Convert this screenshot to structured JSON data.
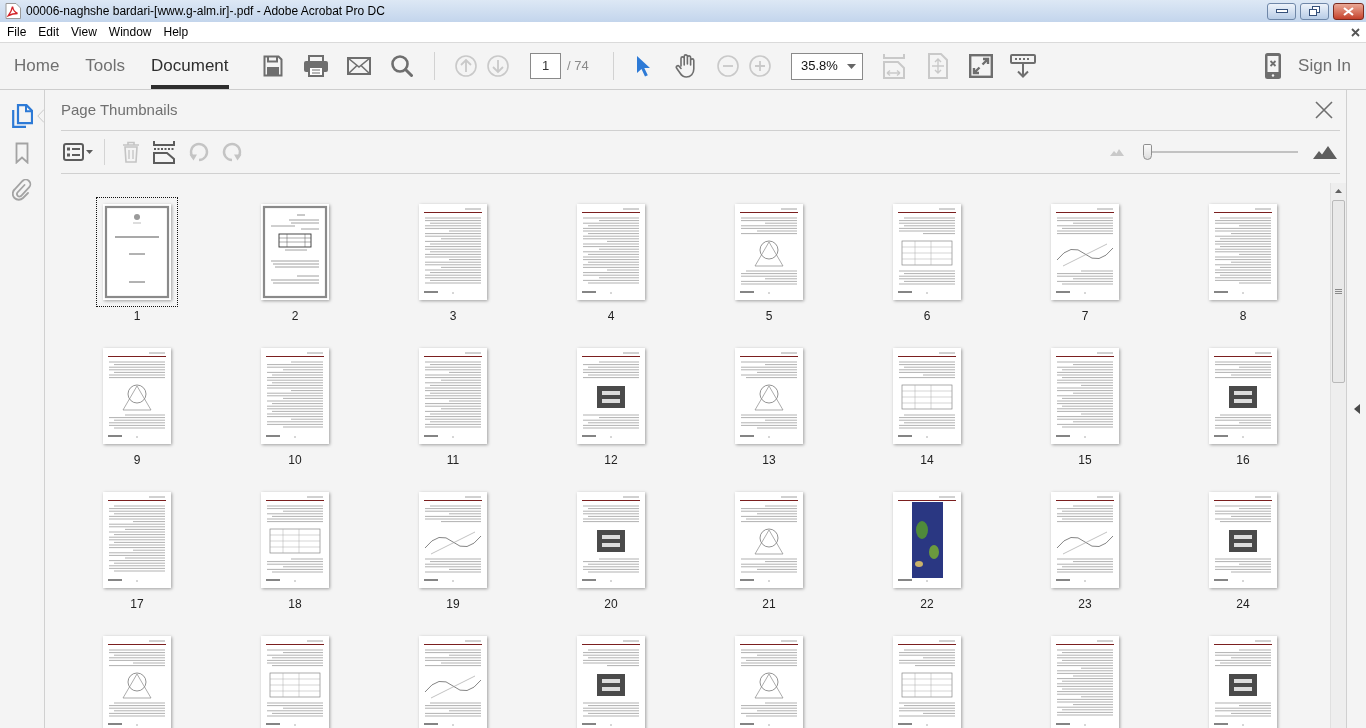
{
  "window": {
    "title": "00006-naghshe bardari-[www.g-alm.ir]-.pdf - Adobe Acrobat Pro DC"
  },
  "menu": [
    "File",
    "Edit",
    "View",
    "Window",
    "Help"
  ],
  "toolbar": {
    "tabs": [
      {
        "label": "Home",
        "selected": false
      },
      {
        "label": "Tools",
        "selected": false
      },
      {
        "label": "Document",
        "selected": true
      }
    ],
    "file_tools": [
      {
        "kind": "save",
        "disabled": false
      },
      {
        "kind": "print",
        "disabled": false
      },
      {
        "kind": "email",
        "disabled": false
      },
      {
        "kind": "search",
        "disabled": false
      }
    ],
    "page_tools": [
      {
        "kind": "previous-page",
        "disabled": true
      },
      {
        "kind": "next-page",
        "disabled": true
      }
    ],
    "page_number": "1",
    "page_count": "/ 74",
    "mode_tools": [
      {
        "kind": "select",
        "selected": true
      },
      {
        "kind": "hand",
        "selected": false
      }
    ],
    "zoom_tools": [
      {
        "kind": "zoom-out",
        "disabled": true
      },
      {
        "kind": "zoom-in",
        "disabled": true
      }
    ],
    "zoom": "35.8%",
    "view_tools": [
      {
        "kind": "fit-width",
        "disabled": true
      },
      {
        "kind": "fit-page",
        "disabled": true
      },
      {
        "kind": "full-screen",
        "disabled": false
      },
      {
        "kind": "read-mode",
        "disabled": false
      }
    ],
    "sign_in": "Sign In"
  },
  "nav_rail": [
    {
      "kind": "pages",
      "selected": true
    },
    {
      "kind": "bookmarks",
      "selected": false
    },
    {
      "kind": "attachments",
      "selected": false
    }
  ],
  "panel": {
    "title": "Page Thumbnails",
    "tools": [
      {
        "kind": "options",
        "disabled": false
      },
      {
        "kind": "delete",
        "disabled": true
      },
      {
        "kind": "insert",
        "disabled": false
      },
      {
        "kind": "rotate-left",
        "disabled": true
      },
      {
        "kind": "rotate-right",
        "disabled": true
      }
    ],
    "thumbnail_size": {
      "level": 0
    },
    "pages": [
      {
        "label": "1",
        "kind": "framed",
        "selected": true
      },
      {
        "label": "2",
        "kind": "framed",
        "selected": false
      },
      {
        "label": "3",
        "kind": "text",
        "selected": false
      },
      {
        "label": "4",
        "kind": "text",
        "selected": false
      },
      {
        "label": "5",
        "kind": "figure",
        "selected": false
      },
      {
        "label": "6",
        "kind": "figure",
        "selected": false
      },
      {
        "label": "7",
        "kind": "figure",
        "selected": false
      },
      {
        "label": "8",
        "kind": "text",
        "selected": false
      },
      {
        "label": "9",
        "kind": "figure",
        "selected": false
      },
      {
        "label": "10",
        "kind": "text",
        "selected": false
      },
      {
        "label": "11",
        "kind": "text",
        "selected": false
      },
      {
        "label": "12",
        "kind": "figure",
        "selected": false
      },
      {
        "label": "13",
        "kind": "figure",
        "selected": false
      },
      {
        "label": "14",
        "kind": "figure",
        "selected": false
      },
      {
        "label": "15",
        "kind": "text",
        "selected": false
      },
      {
        "label": "16",
        "kind": "figure",
        "selected": false
      },
      {
        "label": "17",
        "kind": "text",
        "selected": false
      },
      {
        "label": "18",
        "kind": "figure",
        "selected": false
      },
      {
        "label": "19",
        "kind": "figure",
        "selected": false
      },
      {
        "label": "20",
        "kind": "figure",
        "selected": false
      },
      {
        "label": "21",
        "kind": "figure",
        "selected": false
      },
      {
        "label": "22",
        "kind": "image",
        "selected": false
      },
      {
        "label": "23",
        "kind": "figure",
        "selected": false
      },
      {
        "label": "24",
        "kind": "figure",
        "selected": false
      },
      {
        "kind": "figure",
        "selected": false
      },
      {
        "kind": "figure",
        "selected": false
      },
      {
        "kind": "figure",
        "selected": false
      },
      {
        "kind": "figure",
        "selected": false
      },
      {
        "kind": "figure",
        "selected": false
      },
      {
        "kind": "figure",
        "selected": false
      },
      {
        "kind": "text",
        "selected": false
      },
      {
        "kind": "figure",
        "selected": false
      }
    ]
  }
}
